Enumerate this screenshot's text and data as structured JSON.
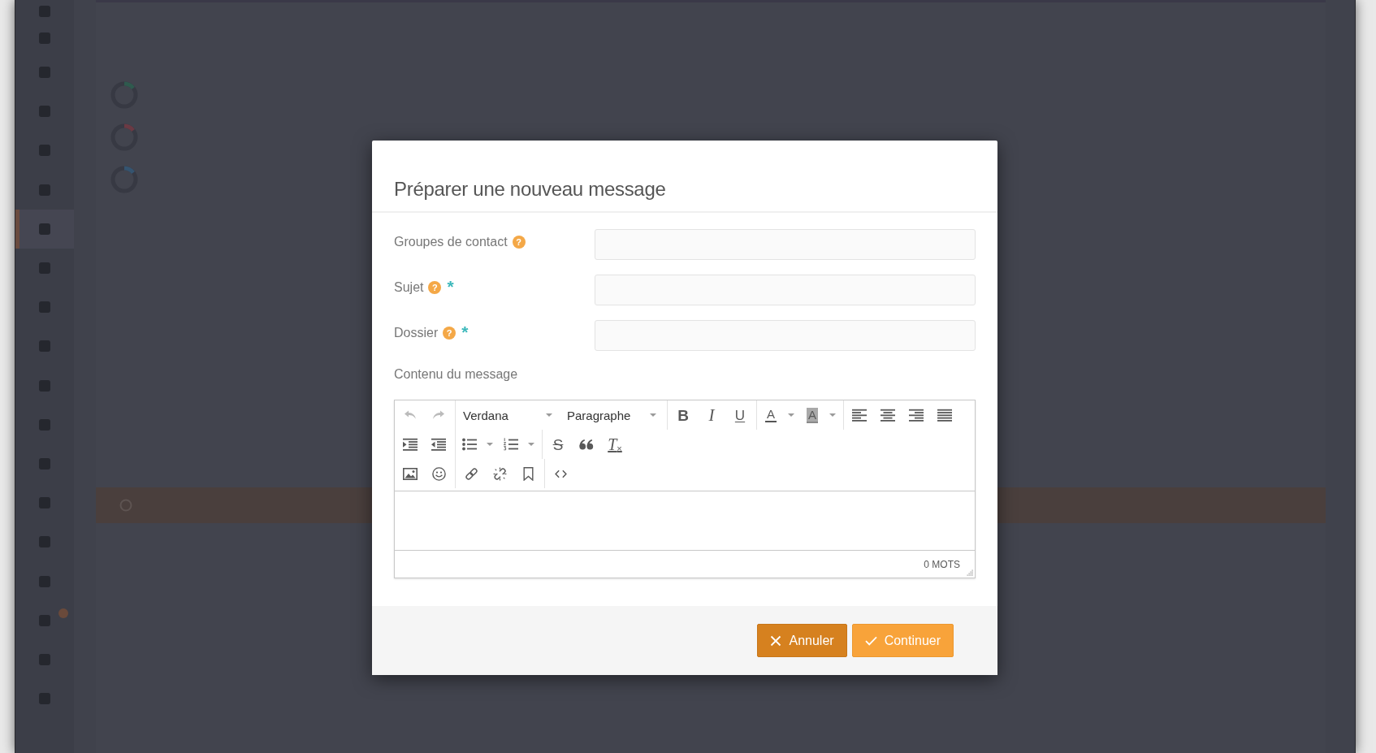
{
  "sidebar": {
    "items": [
      {
        "selected": false,
        "badge": false
      },
      {
        "selected": false,
        "badge": false
      },
      {
        "selected": false,
        "badge": false
      },
      {
        "selected": false,
        "badge": false
      },
      {
        "selected": false,
        "badge": false
      },
      {
        "selected": false,
        "badge": false
      },
      {
        "selected": true,
        "badge": false
      },
      {
        "selected": false,
        "badge": false
      },
      {
        "selected": false,
        "badge": false
      },
      {
        "selected": false,
        "badge": false
      },
      {
        "selected": false,
        "badge": false
      },
      {
        "selected": false,
        "badge": false
      },
      {
        "selected": false,
        "badge": false
      },
      {
        "selected": false,
        "badge": false
      },
      {
        "selected": false,
        "badge": false
      },
      {
        "selected": false,
        "badge": false
      },
      {
        "selected": false,
        "badge": true
      },
      {
        "selected": false,
        "badge": false
      },
      {
        "selected": false,
        "badge": false
      }
    ]
  },
  "content": {
    "rings": [
      {
        "color": "#2f5a4e"
      },
      {
        "color": "#6b3a44"
      },
      {
        "color": "#355470"
      }
    ]
  },
  "dialog": {
    "title": "Préparer une nouveau message",
    "required_mark": "*",
    "fields": [
      {
        "label": "Groupes de contact",
        "help": "?",
        "required": false
      },
      {
        "label": "Sujet",
        "help": "?",
        "required": true
      },
      {
        "label": "Dossier",
        "help": "?",
        "required": true
      }
    ],
    "editor": {
      "label": "Contenu du message",
      "toolbar": {
        "rows": [
          {
            "groups": [
              {
                "items": [
                  {
                    "kind": "undo",
                    "disabled": true
                  },
                  {
                    "kind": "redo",
                    "disabled": true
                  }
                ]
              },
              {
                "items": [
                  {
                    "kind": "fontselect",
                    "label": "Verdana",
                    "disabled": false
                  },
                  {
                    "kind": "formatselect",
                    "label": "Paragraphe",
                    "disabled": false
                  }
                ]
              },
              {
                "items": [
                  {
                    "kind": "bold",
                    "glyph": "B",
                    "disabled": false
                  },
                  {
                    "kind": "italic",
                    "glyph": "I",
                    "disabled": false
                  },
                  {
                    "kind": "underline",
                    "glyph": "U",
                    "disabled": false
                  }
                ]
              },
              {
                "items": [
                  {
                    "kind": "forecolor",
                    "glyph": "A",
                    "disabled": false
                  },
                  {
                    "kind": "backcolor",
                    "glyph": "A",
                    "disabled": false
                  }
                ]
              },
              {
                "items": [
                  {
                    "kind": "alignleft",
                    "disabled": false
                  },
                  {
                    "kind": "aligncenter",
                    "disabled": false
                  },
                  {
                    "kind": "alignright",
                    "disabled": false
                  },
                  {
                    "kind": "alignjustify",
                    "disabled": false
                  }
                ]
              }
            ]
          },
          {
            "groups": [
              {
                "items": [
                  {
                    "kind": "indent",
                    "disabled": false
                  },
                  {
                    "kind": "outdent",
                    "disabled": false
                  }
                ]
              },
              {
                "items": [
                  {
                    "kind": "bullist",
                    "disabled": false
                  },
                  {
                    "kind": "numlist",
                    "disabled": false
                  }
                ]
              },
              {
                "items": [
                  {
                    "kind": "strikethrough",
                    "glyph": "S",
                    "disabled": false
                  },
                  {
                    "kind": "blockquote",
                    "disabled": false
                  },
                  {
                    "kind": "removeformat",
                    "glyph": "T$_{×}$",
                    "disabled": false
                  }
                ]
              }
            ]
          },
          {
            "groups": [
              {
                "items": [
                  {
                    "kind": "image",
                    "disabled": false
                  },
                  {
                    "kind": "emoticons",
                    "disabled": false
                  }
                ]
              },
              {
                "items": [
                  {
                    "kind": "link",
                    "disabled": false
                  },
                  {
                    "kind": "unlink",
                    "disabled": false
                  },
                  {
                    "kind": "anchor",
                    "disabled": false
                  }
                ]
              },
              {
                "items": [
                  {
                    "kind": "code",
                    "disabled": false
                  }
                ]
              }
            ]
          }
        ]
      },
      "word_count": "0 MOTS"
    },
    "buttons": [
      {
        "kind": "cancel",
        "label": "Annuler"
      },
      {
        "kind": "confirm",
        "label": "Continuer"
      }
    ]
  }
}
